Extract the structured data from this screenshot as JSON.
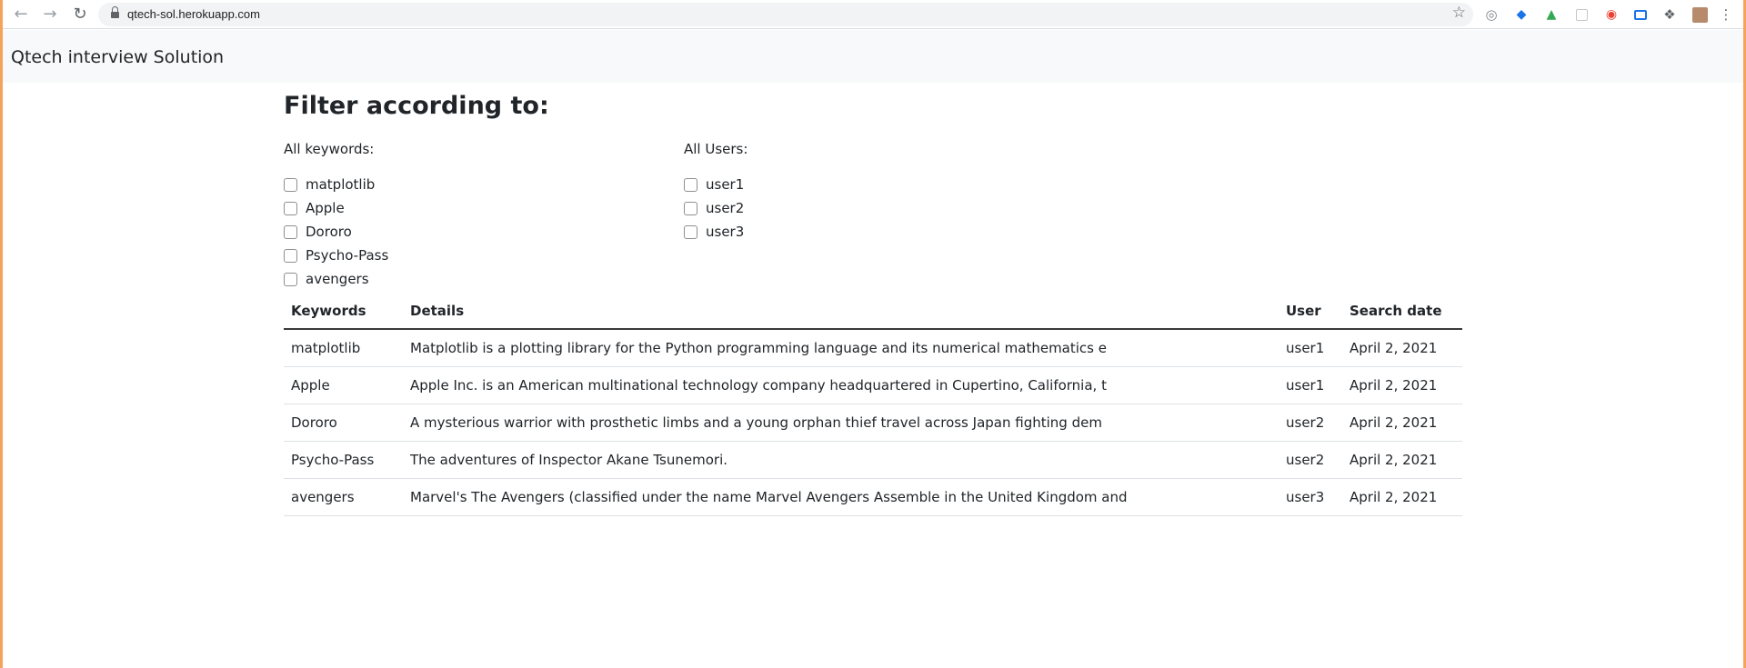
{
  "browser": {
    "url": "qtech-sol.herokuapp.com",
    "nav": {
      "back_icon": "back-arrow-icon",
      "forward_icon": "forward-arrow-icon",
      "reload_icon": "reload-icon"
    }
  },
  "navbar": {
    "brand": "Qtech interview Solution"
  },
  "filters": {
    "heading": "Filter according to:",
    "keywords_label": "All keywords:",
    "keywords": [
      "matplotlib",
      "Apple",
      "Dororo",
      "Psycho-Pass",
      "avengers"
    ],
    "users_label": "All Users:",
    "users": [
      "user1",
      "user2",
      "user3"
    ]
  },
  "table": {
    "columns": [
      "Keywords",
      "Details",
      "User",
      "Search date"
    ],
    "rows": [
      [
        "matplotlib",
        "Matplotlib is a plotting library for the Python programming language and its numerical mathematics e",
        "user1",
        "April 2, 2021"
      ],
      [
        "Apple",
        "Apple Inc. is an American multinational technology company headquartered in Cupertino, California, t",
        "user1",
        "April 2, 2021"
      ],
      [
        "Dororo",
        "A mysterious warrior with prosthetic limbs and a young orphan thief travel across Japan fighting dem",
        "user2",
        "April 2, 2021"
      ],
      [
        "Psycho-Pass",
        "The adventures of Inspector Akane Tsunemori.",
        "user2",
        "April 2, 2021"
      ],
      [
        "avengers",
        "Marvel's The Avengers (classified under the name Marvel Avengers Assemble in the United Kingdom and",
        "user3",
        "April 2, 2021"
      ]
    ]
  },
  "colors": {
    "frame_accent": "#f5a35a",
    "navbar_bg": "#f8f9fa"
  }
}
